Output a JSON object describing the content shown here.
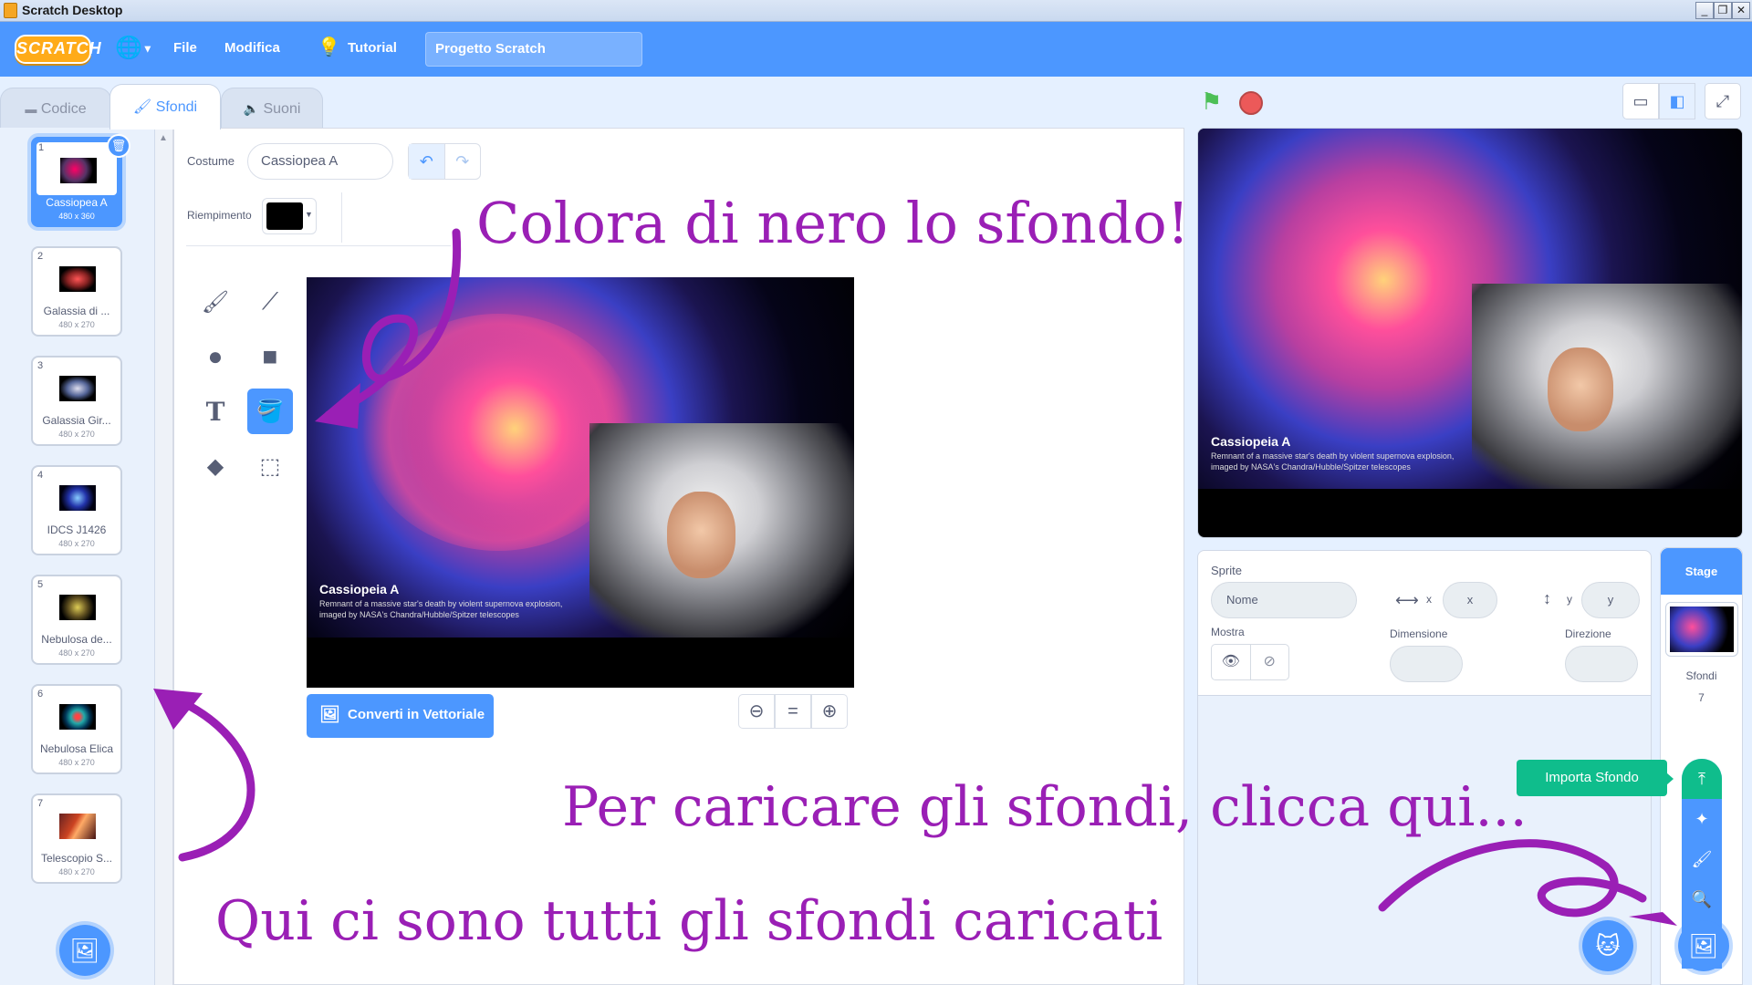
{
  "window": {
    "title": "Scratch Desktop",
    "controls": [
      "_",
      "❐",
      "✕"
    ]
  },
  "menubar": {
    "logo": "SCRATCH",
    "file": "File",
    "edit": "Modifica",
    "tutorials": "Tutorial",
    "project_title": "Progetto Scratch"
  },
  "tabs": [
    {
      "label": "Codice",
      "icon": "code-icon"
    },
    {
      "label": "Sfondi",
      "icon": "brush-icon"
    },
    {
      "label": "Suoni",
      "icon": "speaker-icon"
    }
  ],
  "backdrops": [
    {
      "num": "1",
      "name": "Cassiopea A",
      "size": "480 x 360",
      "color": "#b0306a"
    },
    {
      "num": "2",
      "name": "Galassia di ...",
      "size": "480 x 270",
      "color": "#c02020"
    },
    {
      "num": "3",
      "name": "Galassia Gir...",
      "size": "480 x 270",
      "color": "#5a6ab0"
    },
    {
      "num": "4",
      "name": "IDCS J1426",
      "size": "480 x 270",
      "color": "#2a40c0"
    },
    {
      "num": "5",
      "name": "Nebulosa de...",
      "size": "480 x 270",
      "color": "#b0a040"
    },
    {
      "num": "6",
      "name": "Nebulosa Elica",
      "size": "480 x 270",
      "color": "#20a0a0"
    },
    {
      "num": "7",
      "name": "Telescopio S...",
      "size": "480 x 270",
      "color": "#c04020"
    }
  ],
  "editor": {
    "costume_label": "Costume",
    "costume_name": "Cassiopea A",
    "fill_label": "Riempimento",
    "fill_color": "#000000",
    "convert_button": "Converti in Vettoriale",
    "zoom_reset": "="
  },
  "canvas_caption": {
    "title": "Cassiopeia A",
    "line1": "Remnant of a massive star's death by violent supernova explosion,",
    "line2": "imaged by NASA's Chandra/Hubble/Spitzer telescopes"
  },
  "sprite_info": {
    "sprite_label": "Sprite",
    "name_placeholder": "Nome",
    "x_label": "x",
    "x_placeholder": "x",
    "y_label": "y",
    "y_placeholder": "y",
    "show_label": "Mostra",
    "size_label": "Dimensione",
    "direction_label": "Direzione"
  },
  "stage_pane": {
    "header": "Stage",
    "backdrops_label": "Sfondi",
    "backdrops_count": "7"
  },
  "tooltip": "Importa Sfondo",
  "annotations": {
    "top": "Colora di nero lo sfondo!",
    "middle": "Per caricare gli sfondi, clicca qui...",
    "bottom": "Qui ci sono tutti gli sfondi caricati",
    "color": "#9a1fb5"
  },
  "colors": {
    "accent": "#4c97ff",
    "menubar": "#4c97ff",
    "tooltip": "#0fbd8c",
    "flag": "#4cbf56",
    "stop": "#ec5959"
  }
}
